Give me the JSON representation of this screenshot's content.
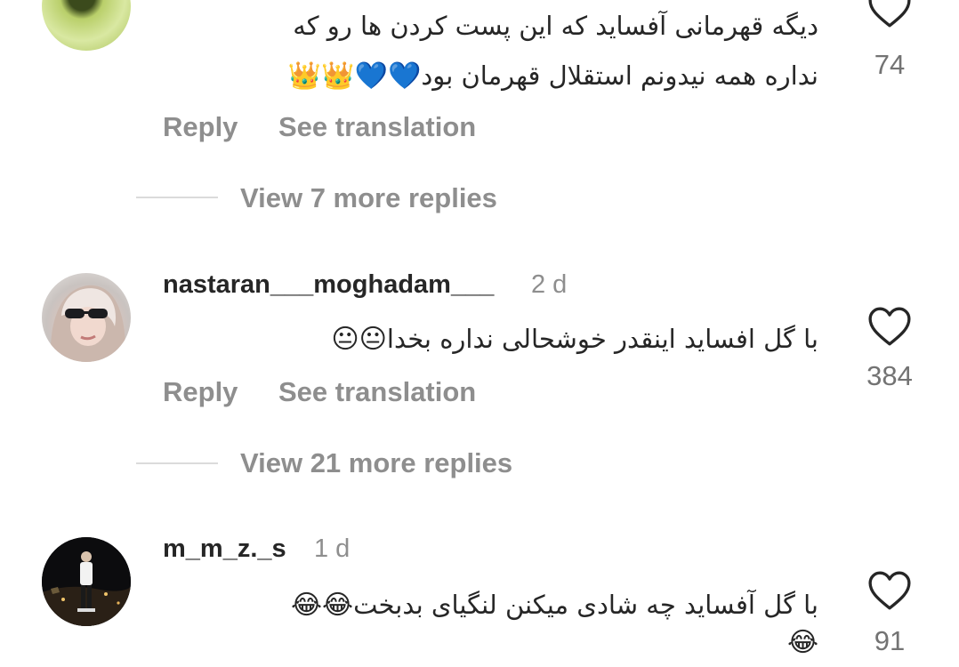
{
  "comments": [
    {
      "username": "",
      "time": "",
      "text_lines": [
        "دیگه قهرمانی آفساید که این پست کردن ها رو که",
        "نداره همه نیدونم استقلال قهرمان بود"
      ],
      "emojis": "💙💙👑👑",
      "likes": "74",
      "reply_label": "Reply",
      "translate_label": "See translation",
      "more_replies": "View 7 more replies"
    },
    {
      "username": "nastaran___moghadam___",
      "time": "2 d",
      "text_lines": [
        "با گل افساید  اینقدر  خوشحالی  نداره بخدا"
      ],
      "emojis": "😐😐",
      "likes": "384",
      "reply_label": "Reply",
      "translate_label": "See translation",
      "more_replies": "View 21 more replies"
    },
    {
      "username": "m_m_z._s",
      "time": "1 d",
      "text_lines": [
        "با گل آفساید چه شادی میکنن لنگیای بدبخت"
      ],
      "emojis": "😂😂",
      "emojis_line2": "😂",
      "likes": "91"
    }
  ],
  "icons": {
    "like": "heart-outline-icon"
  }
}
